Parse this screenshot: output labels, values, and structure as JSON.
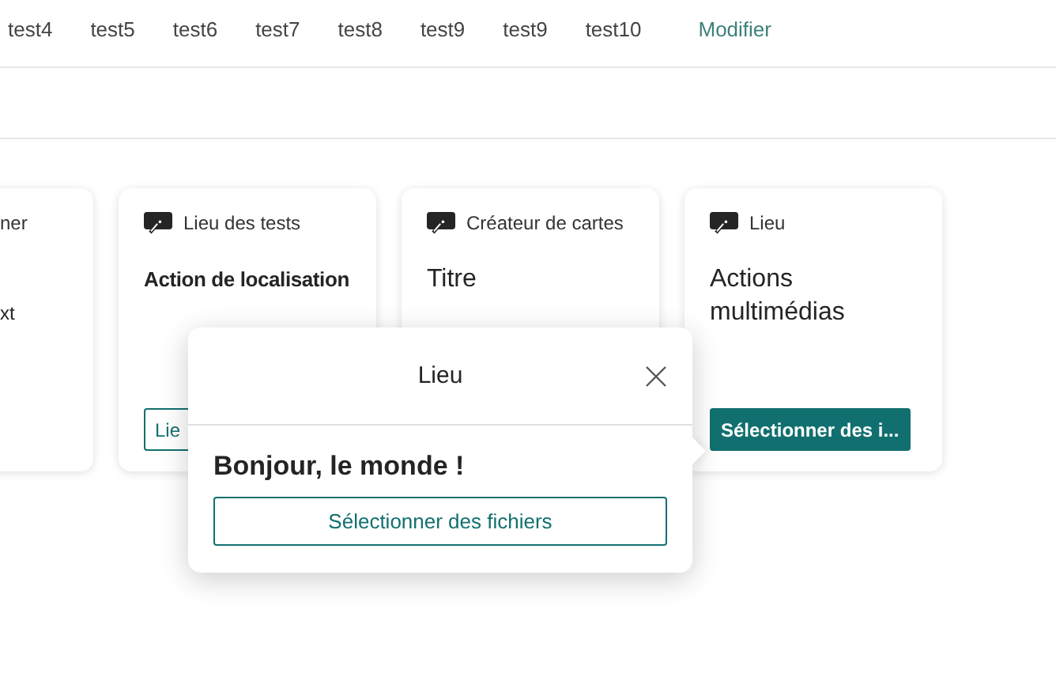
{
  "nav": [
    {
      "label": "test4",
      "kind": "tab"
    },
    {
      "label": "test5",
      "kind": "tab"
    },
    {
      "label": "test6",
      "kind": "tab"
    },
    {
      "label": "test7",
      "kind": "tab"
    },
    {
      "label": "test8",
      "kind": "tab"
    },
    {
      "label": "test9",
      "kind": "tab"
    },
    {
      "label": "test9",
      "kind": "tab"
    },
    {
      "label": "test10",
      "kind": "tab"
    },
    {
      "label": "Modifier",
      "kind": "link"
    }
  ],
  "cards": [
    {
      "kind": "clipped",
      "subtitle": "ner",
      "body": "xt"
    },
    {
      "kind": "card",
      "subtitle": "Lieu des tests",
      "title": "Action de localisation",
      "button": {
        "label": "Lie",
        "kind": "outline"
      }
    },
    {
      "kind": "card",
      "subtitle": "Créateur de cartes",
      "title": "Titre"
    },
    {
      "kind": "card",
      "subtitle": "Lieu",
      "title": "Actions multimédias",
      "button": {
        "label": "Sélectionner des i...",
        "kind": "primary"
      }
    }
  ],
  "popup": {
    "title": "Lieu",
    "heading": "Bonjour, le monde !",
    "button": "Sélectionner des fichiers"
  }
}
